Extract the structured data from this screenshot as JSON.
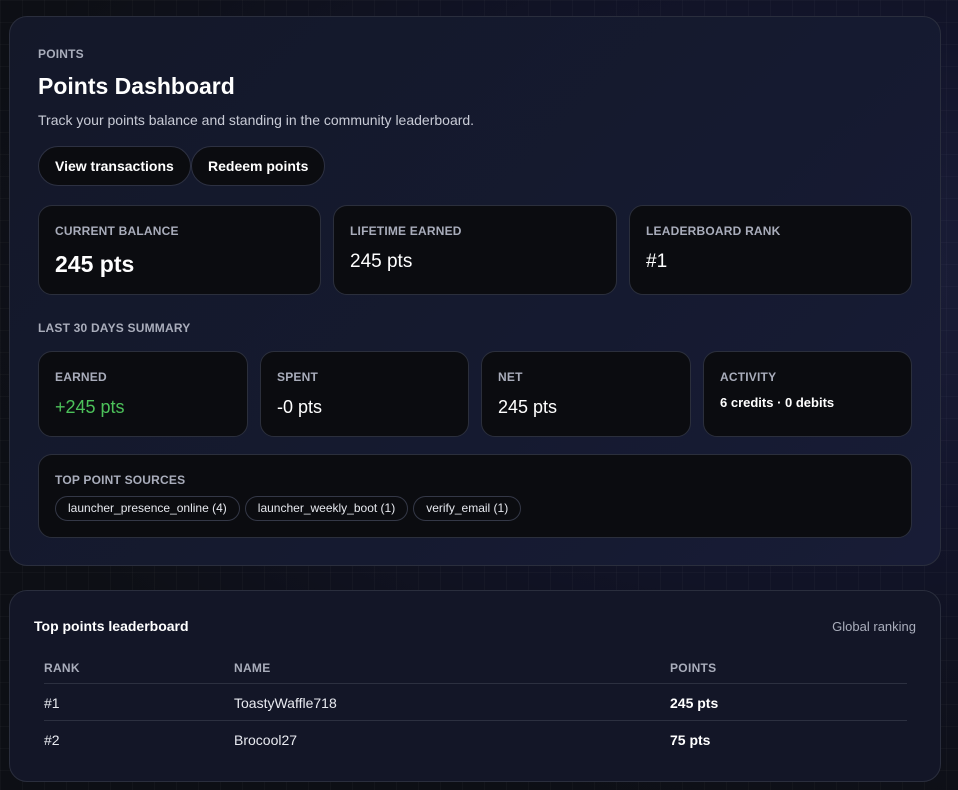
{
  "header": {
    "eyebrow": "POINTS",
    "title": "Points Dashboard",
    "subtitle": "Track your points balance and standing in the community leaderboard."
  },
  "actions": {
    "view_transactions": "View transactions",
    "redeem_points": "Redeem points"
  },
  "stats": {
    "current_balance": {
      "label": "CURRENT BALANCE",
      "value": "245 pts"
    },
    "lifetime_earned": {
      "label": "LIFETIME EARNED",
      "value": "245 pts"
    },
    "leaderboard_rank": {
      "label": "LEADERBOARD RANK",
      "value": "#1"
    }
  },
  "summary": {
    "label": "LAST 30 DAYS SUMMARY",
    "earned": {
      "label": "EARNED",
      "value": "+245 pts"
    },
    "spent": {
      "label": "SPENT",
      "value": "-0 pts"
    },
    "net": {
      "label": "NET",
      "value": "245 pts"
    },
    "activity": {
      "label": "ACTIVITY",
      "value": "6 credits · 0 debits"
    }
  },
  "sources": {
    "label": "TOP POINT SOURCES",
    "items": [
      "launcher_presence_online (4)",
      "launcher_weekly_boot (1)",
      "verify_email (1)"
    ]
  },
  "leaderboard": {
    "title": "Top points leaderboard",
    "meta": "Global ranking",
    "columns": {
      "rank": "RANK",
      "name": "NAME",
      "points": "POINTS"
    },
    "rows": [
      {
        "rank": "#1",
        "name": "ToastyWaffle718",
        "points": "245 pts"
      },
      {
        "rank": "#2",
        "name": "Brocool27",
        "points": "75 pts"
      }
    ]
  },
  "colors": {
    "positive": "#4cc15a",
    "card_bg": "#0b0c10",
    "panel_bg": "#141829"
  }
}
